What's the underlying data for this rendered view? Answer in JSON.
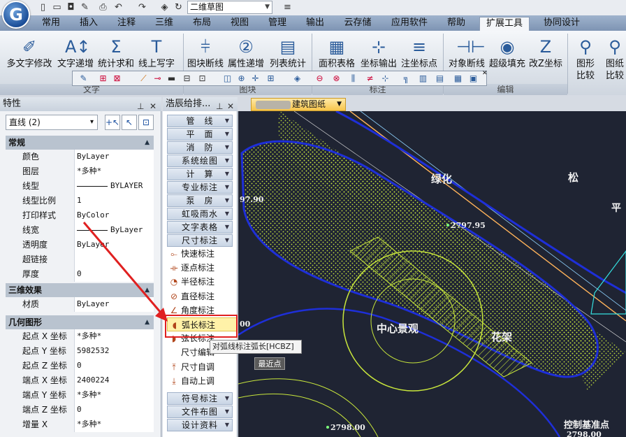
{
  "titlebar": {
    "drawing_name": "二维草图",
    "overflow": "≡"
  },
  "menus": [
    "常用",
    "插入",
    "注释",
    "三维",
    "布局",
    "视图",
    "管理",
    "输出",
    "云存储",
    "应用软件",
    "帮助",
    "扩展工具",
    "协同设计"
  ],
  "active_menu": "扩展工具",
  "ribbon": {
    "buttons": [
      "多文字修改",
      "文字递增",
      "统计求和",
      "线上写字",
      "图块断线",
      "属性递增",
      "列表统计",
      "面积表格",
      "坐标输出",
      "注坐标点",
      "对象断线",
      "超级填充",
      "改Z坐标"
    ],
    "right_buttons": [
      {
        "line1": "图形",
        "line2": "比较"
      },
      {
        "line1": "图纸",
        "line2": "比较"
      }
    ],
    "groups": [
      "文字",
      "图块",
      "标注",
      "编辑"
    ]
  },
  "properties": {
    "title": "特性",
    "object_select": "直线 (2)",
    "sections": {
      "general": {
        "title": "常规",
        "rows": [
          {
            "k": "颜色",
            "v": "ByLayer"
          },
          {
            "k": "图层",
            "v": "*多种*"
          },
          {
            "k": "线型",
            "v": "BYLAYER",
            "line": true
          },
          {
            "k": "线型比例",
            "v": "1"
          },
          {
            "k": "打印样式",
            "v": "ByColor"
          },
          {
            "k": "线宽",
            "v": "ByLayer",
            "line": true
          },
          {
            "k": "透明度",
            "v": "ByLayer"
          },
          {
            "k": "超链接",
            "v": ""
          },
          {
            "k": "厚度",
            "v": "0"
          }
        ]
      },
      "three_d": {
        "title": "三维效果",
        "rows": [
          {
            "k": "材质",
            "v": "ByLayer"
          }
        ]
      },
      "geometry": {
        "title": "几何图形",
        "rows": [
          {
            "k": "起点 X 坐标",
            "v": "*多种*"
          },
          {
            "k": "起点 Y 坐标",
            "v": "5982532"
          },
          {
            "k": "起点 Z 坐标",
            "v": "0"
          },
          {
            "k": "端点 X 坐标",
            "v": "2400224"
          },
          {
            "k": "端点 Y 坐标",
            "v": "*多种*"
          },
          {
            "k": "端点 Z 坐标",
            "v": "0"
          },
          {
            "k": "增量 X",
            "v": "*多种*"
          }
        ]
      }
    }
  },
  "tool_panel": {
    "title": "浩辰给排...",
    "categories_top": [
      "管　线",
      "平　面",
      "消　防",
      "系统绘图",
      "计　算",
      "专业标注",
      "泵　房",
      "虹吸雨水",
      "文字表格",
      "尺寸标注"
    ],
    "items": [
      "快速标注",
      "逐点标注",
      "半径标注",
      "直径标注",
      "角度标注",
      "弧长标注",
      "弦长标注",
      "尺寸编辑",
      "尺寸自调",
      "自动上调"
    ],
    "highlighted_item": "弧长标注",
    "categories_bottom": [
      "符号标注",
      "文件布图",
      "设计资料"
    ]
  },
  "tooltip": "对弧线标注弧长[HCBZ]",
  "snap_hint": "最近点",
  "document_tab": "建筑图纸",
  "drawing_labels": {
    "green": "绿化",
    "pine": "松",
    "flat": "平",
    "center": "中心景观",
    "flower": "花架",
    "elev1": "2797.95",
    "elev2": "97.90",
    "elev3": "00",
    "elev4": "2798.00",
    "control": "控制基准点",
    "elev5": "2798.00"
  },
  "colors": {
    "highlight_red": "#e02020",
    "cad_bg": "#1f2433",
    "hatch": "#c8e63c",
    "boundary": "#1e2fd8"
  }
}
